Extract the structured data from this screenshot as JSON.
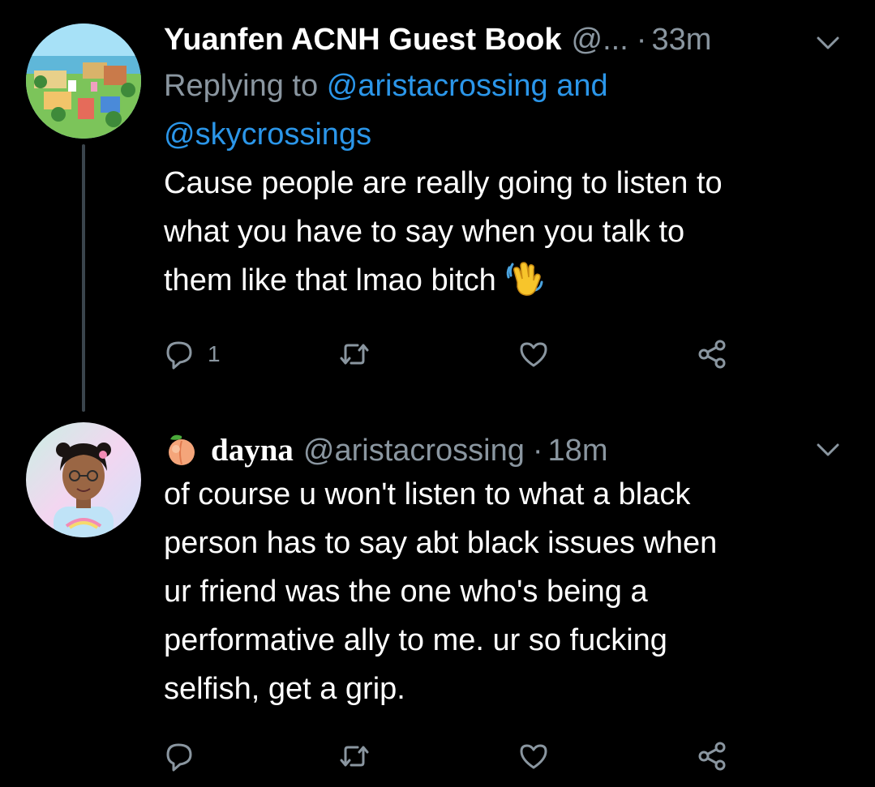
{
  "tweets": [
    {
      "display_name": "Yuanfen ACNH Guest Book",
      "handle": "@...",
      "separator": "·",
      "time": "33m",
      "reply_prefix": "Replying to",
      "reply_to_1": "@aristacrossing",
      "reply_and": "and",
      "reply_to_2": "@skycrossings",
      "text": "Cause people are really going to listen to\nwhat you have to say when you talk to\nthem like that lmao bitch",
      "emoji": "waving-hand-icon",
      "reply_count": "1"
    },
    {
      "emoji_prefix": "peach-icon",
      "display_name": "dayna",
      "handle": "@aristacrossing",
      "separator": "·",
      "time": "18m",
      "text": "of course u won't listen to what a black\nperson has to say abt black issues when\nur friend was the one who's being a\nperformative ally to me. ur so fucking\nselfish, get a grip.",
      "reply_count": ""
    }
  ],
  "colors": {
    "background": "#000000",
    "text": "#ffffff",
    "muted": "#8a96a0",
    "link": "#2b96e9",
    "thread_line": "#3a444c"
  }
}
